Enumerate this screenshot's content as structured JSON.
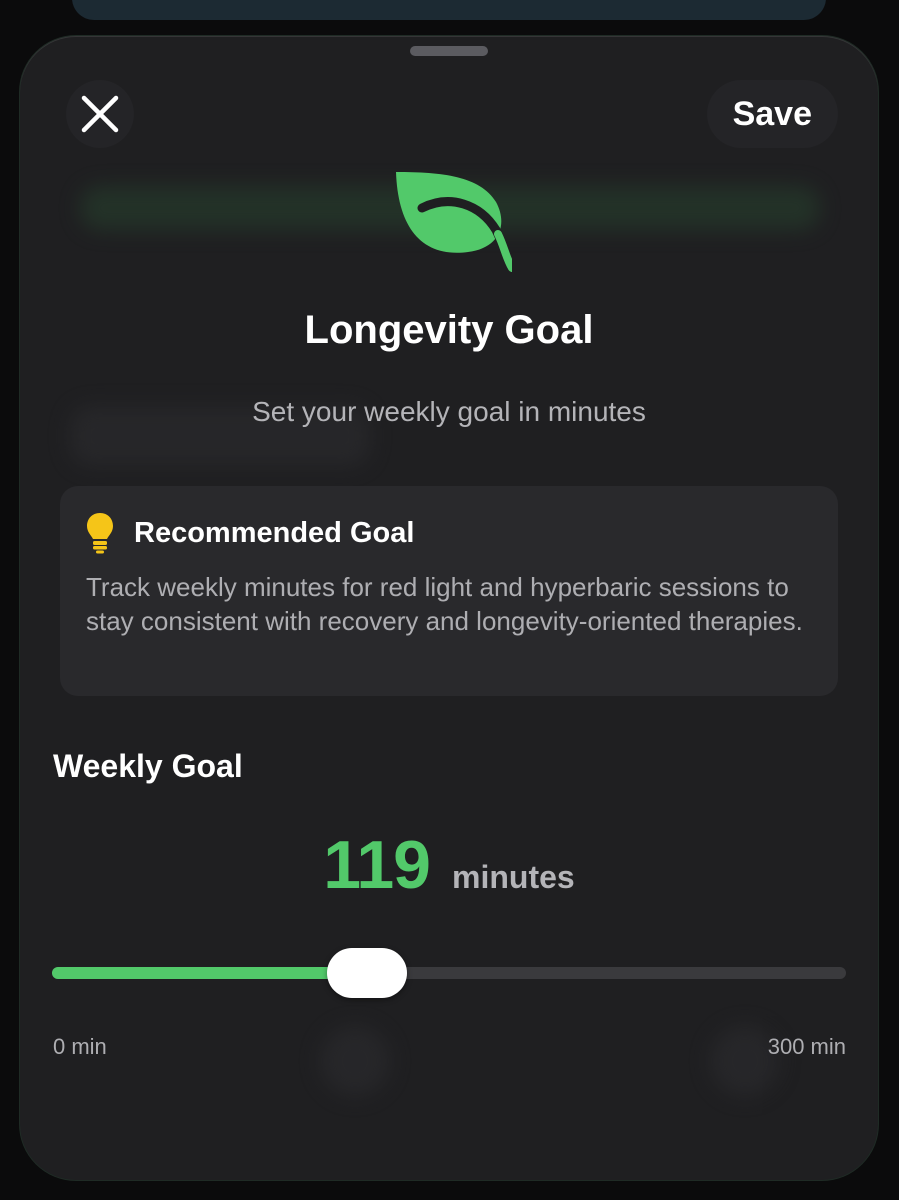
{
  "sheet": {
    "close_icon": "close-icon",
    "save_label": "Save",
    "icon": "leaf-icon",
    "title": "Longevity Goal",
    "subtitle": "Set your weekly goal in minutes"
  },
  "recommendation": {
    "icon": "lightbulb-icon",
    "title": "Recommended Goal",
    "body": "Track weekly minutes for red light and hyperbaric sessions to stay consistent with recovery and longevity-oriented therapies."
  },
  "weekly_goal": {
    "label": "Weekly Goal",
    "value": "119",
    "unit": "minutes",
    "min": 0,
    "max": 300,
    "current": 119,
    "min_label": "0 min",
    "max_label": "300 min"
  },
  "colors": {
    "accent": "#52c96a",
    "sheet_background": "#1f1f21",
    "card_background": "#29292c",
    "bulb": "#f5c518"
  }
}
